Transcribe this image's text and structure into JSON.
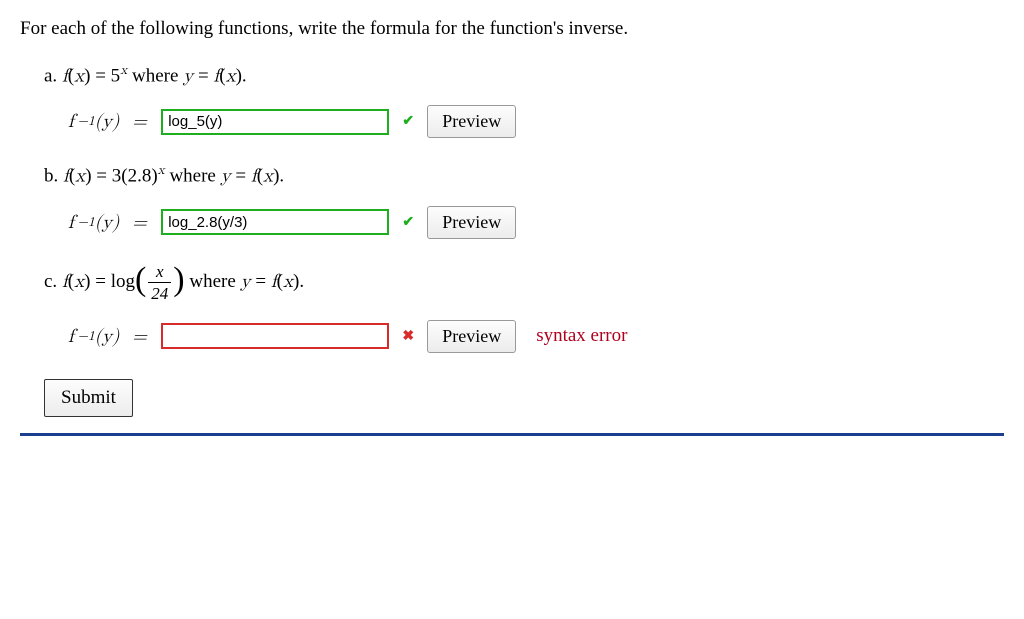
{
  "intro": "For each of the following functions, write the formula for the function's inverse.",
  "parts": {
    "a": {
      "label": "a.",
      "prompt_html": "f(x) = 5<sup>x</sup> where y = f(x).",
      "lhs": "f⁻¹(y) = ",
      "input_value": "log_5(y)",
      "status": "correct",
      "preview": "Preview"
    },
    "b": {
      "label": "b.",
      "prompt_html": "f(x) = 3(2.8)<sup>x</sup> where y = f(x).",
      "lhs": "f⁻¹(y) = ",
      "input_value": "log_2.8(y/3)",
      "status": "correct",
      "preview": "Preview"
    },
    "c": {
      "label": "c.",
      "prompt_plain_prefix": "f(x) = log",
      "frac_num": "x",
      "frac_den": "24",
      "prompt_plain_suffix": " where y = f(x).",
      "lhs": "f⁻¹(y) = ",
      "input_value": "",
      "status": "incorrect",
      "preview": "Preview",
      "error": "syntax error"
    }
  },
  "submit_label": "Submit"
}
